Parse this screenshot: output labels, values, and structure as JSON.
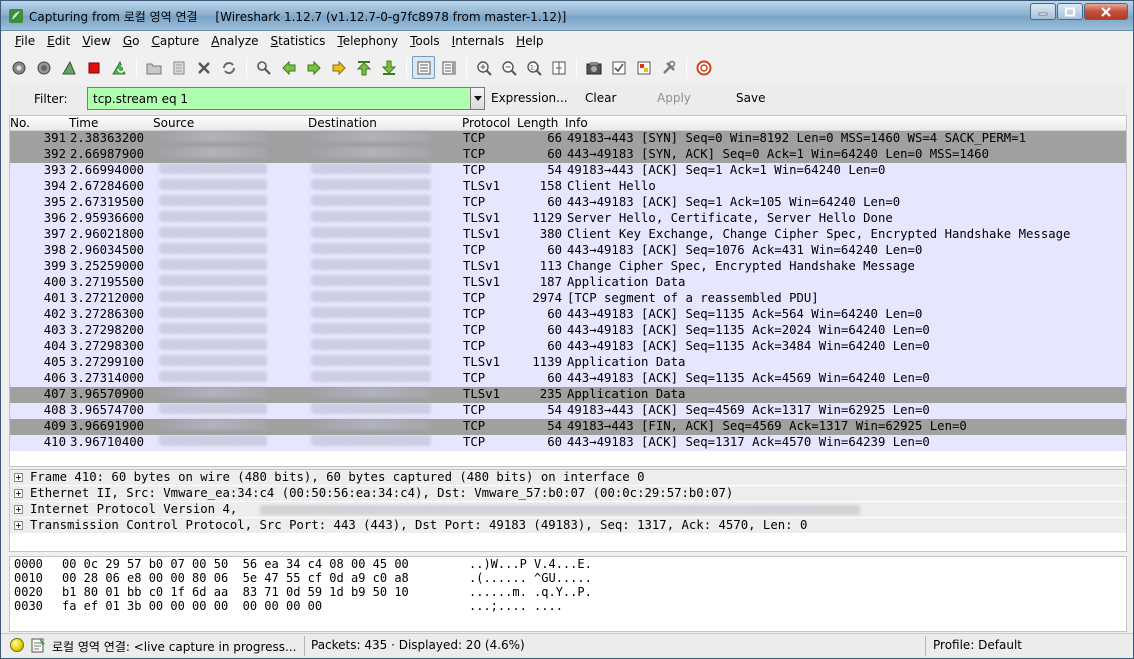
{
  "window": {
    "title": "Capturing from 로컬 영역 연결",
    "subtitle": "[Wireshark 1.12.7  (v1.12.7-0-g7fc8978 from master-1.12)]"
  },
  "menu": [
    "File",
    "Edit",
    "View",
    "Go",
    "Capture",
    "Analyze",
    "Statistics",
    "Telephony",
    "Tools",
    "Internals",
    "Help"
  ],
  "toolbar_icons": [
    "interface-list-icon",
    "capture-options-icon",
    "start-capture-icon",
    "stop-capture-icon",
    "restart-capture-icon",
    "open-file-icon",
    "save-file-icon",
    "close-file-icon",
    "reload-icon",
    "find-packet-icon",
    "go-back-icon",
    "go-forward-icon",
    "go-to-packet-icon",
    "go-first-icon",
    "go-last-icon",
    "colorize-icon",
    "autoscroll-icon",
    "zoom-in-icon",
    "zoom-out-icon",
    "zoom-normal-icon",
    "resize-columns-icon",
    "capture-filters-icon",
    "display-filters-icon",
    "coloring-rules-icon",
    "preferences-icon",
    "help-icon"
  ],
  "filter": {
    "label": "Filter:",
    "value": "tcp.stream eq 1",
    "expression": "Expression...",
    "clear": "Clear",
    "apply": "Apply",
    "save": "Save"
  },
  "columns": [
    "No.",
    "Time",
    "Source",
    "Destination",
    "Protocol",
    "Length",
    "Info"
  ],
  "colors": {
    "row_default": "#e7e6ff",
    "row_selected_grey": "#a0a0a0",
    "filter_bg": "#afffaf"
  },
  "packets": [
    {
      "no": "391",
      "time": "2.38363200",
      "proto": "TCP",
      "len": "66",
      "info": "49183→443 [SYN] Seq=0 Win=8192 Len=0 MSS=1460 WS=4 SACK_PERM=1",
      "style": "grey"
    },
    {
      "no": "392",
      "time": "2.66987900",
      "proto": "TCP",
      "len": "60",
      "info": "443→49183 [SYN, ACK] Seq=0 Ack=1 Win=64240 Len=0 MSS=1460",
      "style": "grey"
    },
    {
      "no": "393",
      "time": "2.66994000",
      "proto": "TCP",
      "len": "54",
      "info": "49183→443 [ACK] Seq=1 Ack=1 Win=64240 Len=0",
      "style": "normal"
    },
    {
      "no": "394",
      "time": "2.67284600",
      "proto": "TLSv1",
      "len": "158",
      "info": "Client Hello",
      "style": "normal"
    },
    {
      "no": "395",
      "time": "2.67319500",
      "proto": "TCP",
      "len": "60",
      "info": "443→49183 [ACK] Seq=1 Ack=105 Win=64240 Len=0",
      "style": "normal"
    },
    {
      "no": "396",
      "time": "2.95936600",
      "proto": "TLSv1",
      "len": "1129",
      "info": "Server Hello, Certificate, Server Hello Done",
      "style": "normal"
    },
    {
      "no": "397",
      "time": "2.96021800",
      "proto": "TLSv1",
      "len": "380",
      "info": "Client Key Exchange, Change Cipher Spec, Encrypted Handshake Message",
      "style": "normal"
    },
    {
      "no": "398",
      "time": "2.96034500",
      "proto": "TCP",
      "len": "60",
      "info": "443→49183 [ACK] Seq=1076 Ack=431 Win=64240 Len=0",
      "style": "normal"
    },
    {
      "no": "399",
      "time": "3.25259000",
      "proto": "TLSv1",
      "len": "113",
      "info": "Change Cipher Spec, Encrypted Handshake Message",
      "style": "normal"
    },
    {
      "no": "400",
      "time": "3.27195500",
      "proto": "TLSv1",
      "len": "187",
      "info": "Application Data",
      "style": "normal"
    },
    {
      "no": "401",
      "time": "3.27212000",
      "proto": "TCP",
      "len": "2974",
      "info": "[TCP segment of a reassembled PDU]",
      "style": "normal"
    },
    {
      "no": "402",
      "time": "3.27286300",
      "proto": "TCP",
      "len": "60",
      "info": "443→49183 [ACK] Seq=1135 Ack=564 Win=64240 Len=0",
      "style": "normal"
    },
    {
      "no": "403",
      "time": "3.27298200",
      "proto": "TCP",
      "len": "60",
      "info": "443→49183 [ACK] Seq=1135 Ack=2024 Win=64240 Len=0",
      "style": "normal"
    },
    {
      "no": "404",
      "time": "3.27298300",
      "proto": "TCP",
      "len": "60",
      "info": "443→49183 [ACK] Seq=1135 Ack=3484 Win=64240 Len=0",
      "style": "normal"
    },
    {
      "no": "405",
      "time": "3.27299100",
      "proto": "TLSv1",
      "len": "1139",
      "info": "Application Data",
      "style": "normal"
    },
    {
      "no": "406",
      "time": "3.27314000",
      "proto": "TCP",
      "len": "60",
      "info": "443→49183 [ACK] Seq=1135 Ack=4569 Win=64240 Len=0",
      "style": "normal"
    },
    {
      "no": "407",
      "time": "3.96570900",
      "proto": "TLSv1",
      "len": "235",
      "info": "Application Data",
      "style": "grey"
    },
    {
      "no": "408",
      "time": "3.96574700",
      "proto": "TCP",
      "len": "54",
      "info": "49183→443 [ACK] Seq=4569 Ack=1317 Win=62925 Len=0",
      "style": "normal"
    },
    {
      "no": "409",
      "time": "3.96691900",
      "proto": "TCP",
      "len": "54",
      "info": "49183→443 [FIN, ACK] Seq=4569 Ack=1317 Win=62925 Len=0",
      "style": "grey"
    },
    {
      "no": "410",
      "time": "3.96710400",
      "proto": "TCP",
      "len": "60",
      "info": "443→49183 [ACK] Seq=1317 Ack=4570 Win=64239 Len=0",
      "style": "normal"
    }
  ],
  "details": [
    "Frame 410: 60 bytes on wire (480 bits), 60 bytes captured (480 bits) on interface 0",
    "Ethernet II, Src: Vmware_ea:34:c4 (00:50:56:ea:34:c4), Dst: Vmware_57:b0:07 (00:0c:29:57:b0:07)",
    "Internet Protocol Version 4,",
    "Transmission Control Protocol, Src Port: 443 (443), Dst Port: 49183 (49183), Seq: 1317, Ack: 4570, Len: 0"
  ],
  "hex": [
    {
      "off": "0000",
      "bytes": "00 0c 29 57 b0 07 00 50  56 ea 34 c4 08 00 45 00",
      "ascii": "..)W...P V.4...E."
    },
    {
      "off": "0010",
      "bytes": "00 28 06 e8 00 00 80 06  5e 47 55 cf 0d a9 c0 a8",
      "ascii": ".(...... ^GU....."
    },
    {
      "off": "0020",
      "bytes": "b1 80 01 bb c0 1f 6d aa  83 71 0d 59 1d b9 50 10",
      "ascii": "......m. .q.Y..P."
    },
    {
      "off": "0030",
      "bytes": "fa ef 01 3b 00 00 00 00  00 00 00 00",
      "ascii": "...;.... ...."
    }
  ],
  "status": {
    "capture": "로컬 영역 연결: <live capture in progress...",
    "packets": "Packets: 435 · Displayed: 20 (4.6%)",
    "profile": "Profile: Default"
  }
}
